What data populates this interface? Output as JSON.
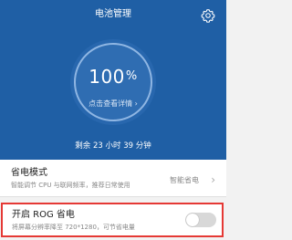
{
  "header": {
    "title": "电池管理",
    "settings_icon": "gear-icon",
    "background_color": "#1f5fa5"
  },
  "battery": {
    "percent": "100",
    "percent_symbol": "%",
    "check_label": "点击查看详情",
    "check_arrow": "›",
    "remaining_text": "剩余 23 小时 39 分钟"
  },
  "power_saving": {
    "title": "省电模式",
    "description": "智能调节 CPU 与联网频率，推荐日常使用",
    "value": "智能省电",
    "arrow": "›"
  },
  "rog": {
    "title": "开启 ROG 省电",
    "description": "将屏幕分辨率降至 720*1280，可节省电量",
    "toggle_on": false,
    "highlight_color": "#e53935"
  }
}
